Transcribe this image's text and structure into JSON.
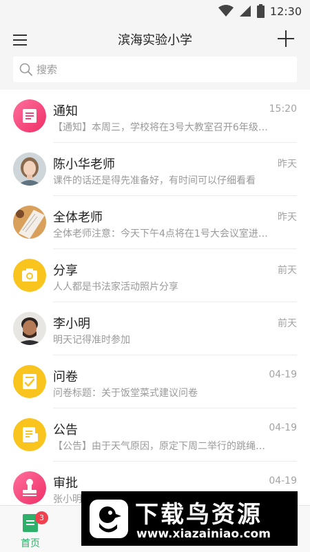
{
  "status_bar": {
    "time": "12:30"
  },
  "header": {
    "title": "滨海实验小学"
  },
  "search": {
    "placeholder": "搜索"
  },
  "conversations": [
    {
      "name": "通知",
      "time": "15:20",
      "preview": "【通知】本周三，学校将在3号大教室召开6年级…",
      "icon": "document-icon",
      "color": "#f5437b"
    },
    {
      "name": "陈小华老师",
      "time": "昨天",
      "preview": "课件的话还是得先准备好，有时间可以仔细看看",
      "icon": "person-photo-avatar",
      "color": ""
    },
    {
      "name": "全体老师",
      "time": "昨天",
      "preview": "全体老师注意：今天下午4点将在1号大会议室进…",
      "icon": "group-photo-avatar",
      "color": ""
    },
    {
      "name": "分享",
      "time": "前天",
      "preview": "人人都是书法家活动照片分享",
      "icon": "camera-icon",
      "color": "#f9c41d"
    },
    {
      "name": "李小明",
      "time": "前天",
      "preview": "明天记得准时参加",
      "icon": "person-photo-avatar",
      "color": ""
    },
    {
      "name": "问卷",
      "time": "04-19",
      "preview": "问卷标题：关于饭堂菜式建议问卷",
      "icon": "checklist-icon",
      "color": "#f9c41d"
    },
    {
      "name": "公告",
      "time": "04-19",
      "preview": "【公告】由于天气原因，原定下周二举行的跳绳…",
      "icon": "announcement-icon",
      "color": "#f9c41d"
    },
    {
      "name": "审批",
      "time": "04-19",
      "preview": "张小明",
      "icon": "stamp-icon",
      "color": "#f5437b"
    }
  ],
  "tabbar": {
    "home_label": "首页",
    "home_badge": "3",
    "accent": "#2eaf6a"
  },
  "watermark": {
    "title": "下载鸟资源",
    "url": "www.xiazainiao.com"
  }
}
